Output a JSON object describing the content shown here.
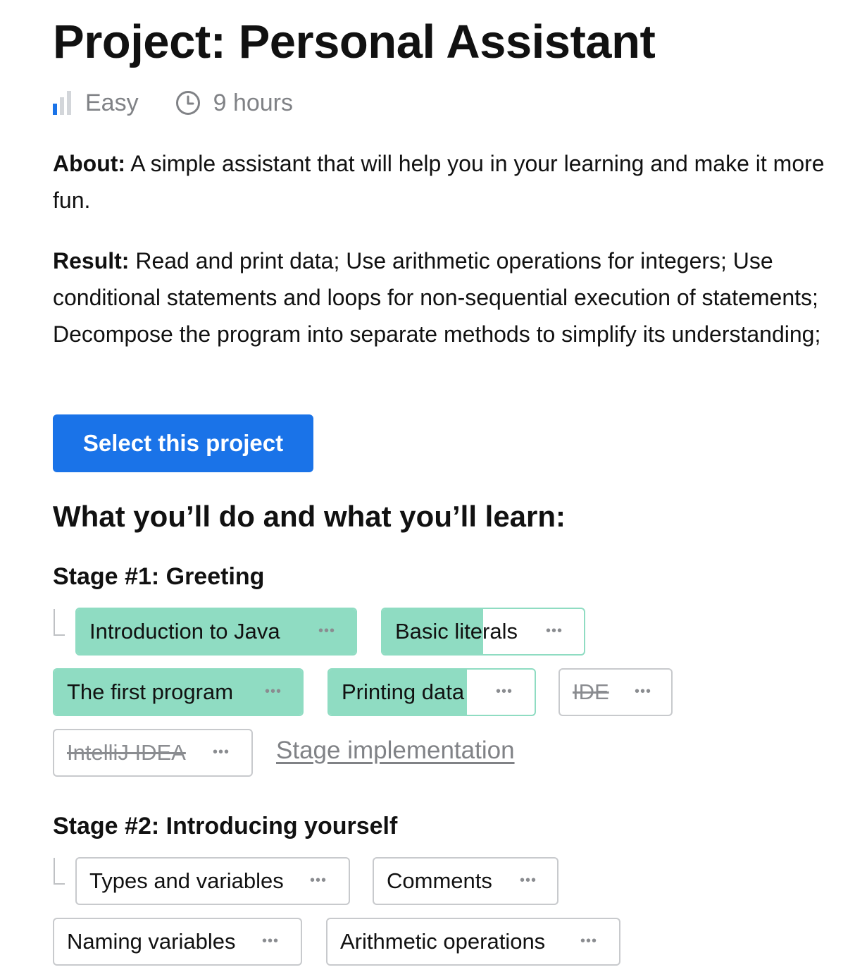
{
  "project": {
    "title": "Project: Personal Assistant",
    "difficulty": "Easy",
    "difficulty_icon": "difficulty-bars-icon",
    "duration": "9 hours",
    "duration_icon": "clock-icon",
    "about_label": "About:",
    "about_text": " A simple assistant that will help you in your learning and make it more fun.",
    "result_label": "Result:",
    "result_text": " Read and print data; Use arithmetic operations for integers; Use conditional statements and loops for non-sequential execution of statements; Decompose the program into separate methods to simplify its understanding;",
    "select_button": "Select this project",
    "section_heading": "What you’ll do and what you’ll learn:"
  },
  "colors": {
    "accent": "#1a73e8",
    "completed_fill": "#8fdcc2",
    "muted_text": "#808286",
    "chip_border": "#c8cacd"
  },
  "stages": [
    {
      "label": "Stage #1:",
      "name": " Greeting",
      "topics": [
        {
          "label": "Introduction to Java",
          "menu": "•••",
          "progress": 1.0,
          "struck": false
        },
        {
          "label": "Basic literals",
          "menu": "•••",
          "progress": 0.5,
          "struck": false
        },
        {
          "label": "The first program",
          "menu": "•••",
          "progress": 1.0,
          "struck": false
        },
        {
          "label": "Printing data",
          "menu": "•••",
          "progress": 0.67,
          "struck": false
        },
        {
          "label": "IDE",
          "menu": "•••",
          "progress": 0,
          "struck": true
        },
        {
          "label": "IntelliJ IDEA",
          "menu": "•••",
          "progress": 0,
          "struck": true
        }
      ],
      "link": "Stage implementation"
    },
    {
      "label": "Stage #2:",
      "name": " Introducing yourself",
      "topics": [
        {
          "label": "Types and variables",
          "menu": "•••",
          "progress": 0,
          "struck": false
        },
        {
          "label": "Comments",
          "menu": "•••",
          "progress": 0,
          "struck": false
        },
        {
          "label": "Naming variables",
          "menu": "•••",
          "progress": 0,
          "struck": false
        },
        {
          "label": "Arithmetic operations",
          "menu": "•••",
          "progress": 0,
          "struck": false
        }
      ]
    }
  ]
}
